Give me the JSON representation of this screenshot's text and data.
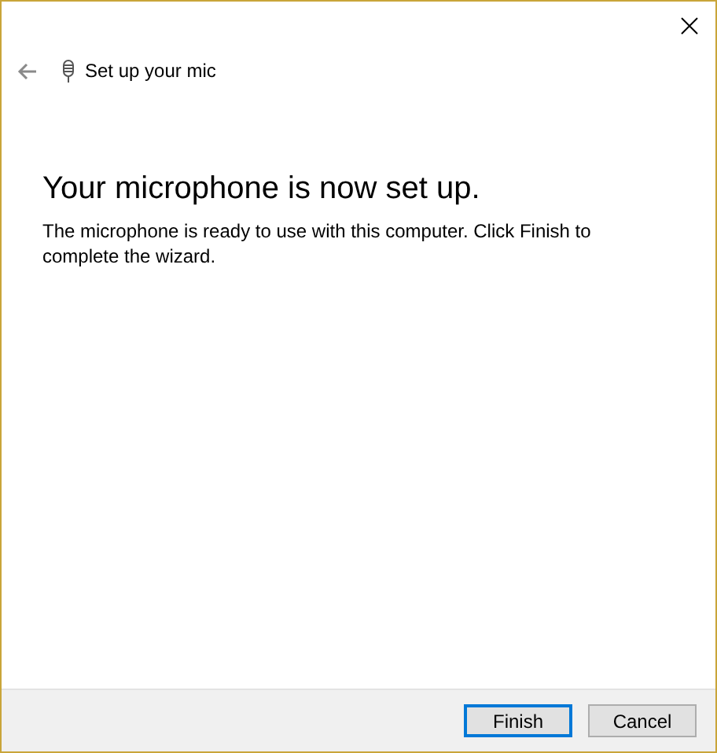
{
  "header": {
    "title": "Set up your mic",
    "back_disabled": true
  },
  "heading": "Your microphone is now set up.",
  "body": "The microphone is ready to use with this computer. Click Finish to complete the wizard.",
  "buttons": [
    {
      "label": "Finish",
      "default": true
    },
    {
      "label": "Cancel",
      "default": false
    }
  ]
}
